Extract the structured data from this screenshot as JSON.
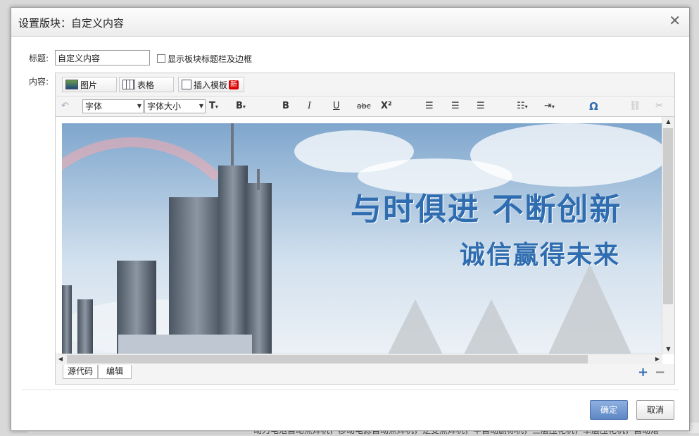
{
  "dialog": {
    "title": "设置版块：自定义内容",
    "close_glyph": "✕"
  },
  "form": {
    "title_label": "标题:",
    "title_value": "自定义内容",
    "show_border_label": "显示板块标题栏及边框",
    "content_label": "内容:"
  },
  "toolbar1": {
    "image_label": "图片",
    "table_label": "表格",
    "template_label": "插入模板",
    "new_badge": "新"
  },
  "toolbar2": {
    "font_family": "字体",
    "font_size": "字体大小",
    "bold": "B",
    "italic": "I",
    "underline": "U",
    "strike": "abc",
    "superscript": "X²",
    "omega": "Ω"
  },
  "banner": {
    "slogan_line1": "与时俱进 不断创新",
    "slogan_line2": "诚信赢得未来"
  },
  "editor_bottom": {
    "source_tab": "源代码",
    "edit_tab": "编辑",
    "zoom_in": "+",
    "zoom_out": "−"
  },
  "footer": {
    "ok_label": "确定",
    "cancel_label": "取消"
  },
  "background": {
    "footer_text": "动力电池自动点焊机，移动电源自动点焊机，逆变点焊机，半自动删标机，三层压花机，单层压花机，自动烙"
  },
  "colors": {
    "accent": "#5d86c4",
    "slogan": "#2f6db0",
    "badge": "#dd0000"
  }
}
